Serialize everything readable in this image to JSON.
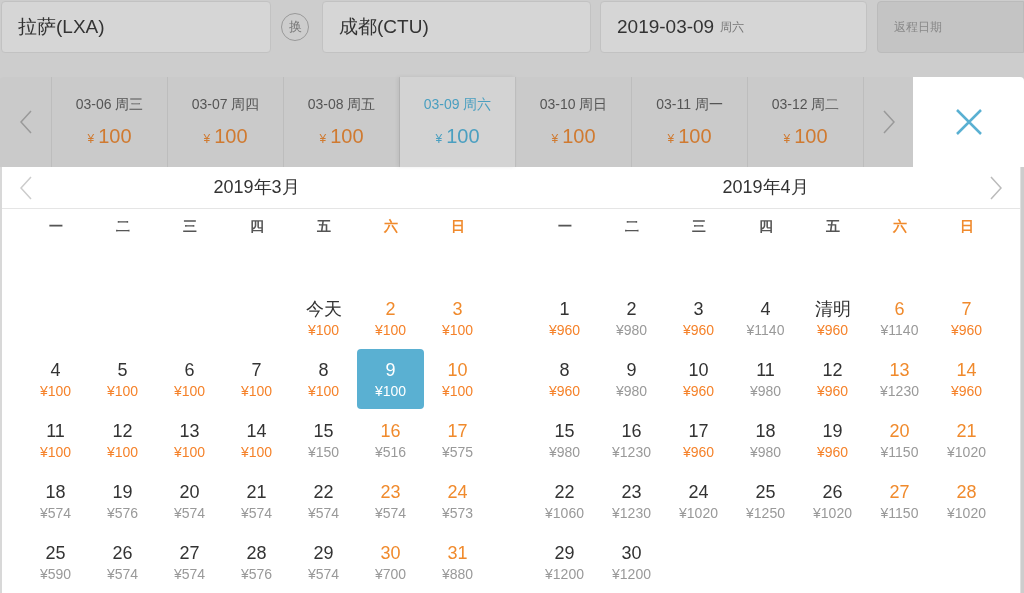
{
  "search": {
    "origin": "拉萨(LXA)",
    "swap": "换",
    "destination": "成都(CTU)",
    "depart_date": "2019-03-09",
    "depart_weekday": "周六",
    "return_placeholder": "返程日期"
  },
  "date_strip": [
    {
      "date": "03-06 周三",
      "currency": "¥",
      "price": "100",
      "selected": false
    },
    {
      "date": "03-07 周四",
      "currency": "¥",
      "price": "100",
      "selected": false
    },
    {
      "date": "03-08 周五",
      "currency": "¥",
      "price": "100",
      "selected": false
    },
    {
      "date": "03-09 周六",
      "currency": "¥",
      "price": "100",
      "selected": true
    },
    {
      "date": "03-10 周日",
      "currency": "¥",
      "price": "100",
      "selected": false
    },
    {
      "date": "03-11 周一",
      "currency": "¥",
      "price": "100",
      "selected": false
    },
    {
      "date": "03-12 周二",
      "currency": "¥",
      "price": "100",
      "selected": false
    }
  ],
  "calendars": [
    {
      "title": "2019年3月",
      "prev_arrow": true,
      "first_week_right_aligned": true,
      "weekdays": [
        {
          "label": "一",
          "weekend": false
        },
        {
          "label": "二",
          "weekend": false
        },
        {
          "label": "三",
          "weekend": false
        },
        {
          "label": "四",
          "weekend": false
        },
        {
          "label": "五",
          "weekend": false
        },
        {
          "label": "六",
          "weekend": true
        },
        {
          "label": "日",
          "weekend": true
        }
      ],
      "weeks": [
        [
          {
            "day": "今天",
            "price": "¥100",
            "low": true,
            "selected": false
          },
          {
            "day": "2",
            "price": "¥100",
            "low": true,
            "selected": false
          },
          {
            "day": "3",
            "price": "¥100",
            "low": true,
            "selected": false
          }
        ],
        [
          {
            "day": "4",
            "price": "¥100",
            "low": true,
            "selected": false
          },
          {
            "day": "5",
            "price": "¥100",
            "low": true,
            "selected": false
          },
          {
            "day": "6",
            "price": "¥100",
            "low": true,
            "selected": false
          },
          {
            "day": "7",
            "price": "¥100",
            "low": true,
            "selected": false
          },
          {
            "day": "8",
            "price": "¥100",
            "low": true,
            "selected": false
          },
          {
            "day": "9",
            "price": "¥100",
            "low": true,
            "selected": true
          },
          {
            "day": "10",
            "price": "¥100",
            "low": true,
            "selected": false
          }
        ],
        [
          {
            "day": "11",
            "price": "¥100",
            "low": true,
            "selected": false
          },
          {
            "day": "12",
            "price": "¥100",
            "low": true,
            "selected": false
          },
          {
            "day": "13",
            "price": "¥100",
            "low": true,
            "selected": false
          },
          {
            "day": "14",
            "price": "¥100",
            "low": true,
            "selected": false
          },
          {
            "day": "15",
            "price": "¥150",
            "low": false,
            "selected": false
          },
          {
            "day": "16",
            "price": "¥516",
            "low": false,
            "selected": false
          },
          {
            "day": "17",
            "price": "¥575",
            "low": false,
            "selected": false
          }
        ],
        [
          {
            "day": "18",
            "price": "¥574",
            "low": false,
            "selected": false
          },
          {
            "day": "19",
            "price": "¥576",
            "low": false,
            "selected": false
          },
          {
            "day": "20",
            "price": "¥574",
            "low": false,
            "selected": false
          },
          {
            "day": "21",
            "price": "¥574",
            "low": false,
            "selected": false
          },
          {
            "day": "22",
            "price": "¥574",
            "low": false,
            "selected": false
          },
          {
            "day": "23",
            "price": "¥574",
            "low": false,
            "selected": false
          },
          {
            "day": "24",
            "price": "¥573",
            "low": false,
            "selected": false
          }
        ],
        [
          {
            "day": "25",
            "price": "¥590",
            "low": false,
            "selected": false
          },
          {
            "day": "26",
            "price": "¥574",
            "low": false,
            "selected": false
          },
          {
            "day": "27",
            "price": "¥574",
            "low": false,
            "selected": false
          },
          {
            "day": "28",
            "price": "¥576",
            "low": false,
            "selected": false
          },
          {
            "day": "29",
            "price": "¥574",
            "low": false,
            "selected": false
          },
          {
            "day": "30",
            "price": "¥700",
            "low": false,
            "selected": false
          },
          {
            "day": "31",
            "price": "¥880",
            "low": false,
            "selected": false
          }
        ]
      ]
    },
    {
      "title": "2019年4月",
      "next_arrow": true,
      "weekdays": [
        {
          "label": "一",
          "weekend": false
        },
        {
          "label": "二",
          "weekend": false
        },
        {
          "label": "三",
          "weekend": false
        },
        {
          "label": "四",
          "weekend": false
        },
        {
          "label": "五",
          "weekend": false
        },
        {
          "label": "六",
          "weekend": true
        },
        {
          "label": "日",
          "weekend": true
        }
      ],
      "weeks": [
        [
          {
            "day": "1",
            "price": "¥960",
            "low": true,
            "selected": false
          },
          {
            "day": "2",
            "price": "¥980",
            "low": false,
            "selected": false
          },
          {
            "day": "3",
            "price": "¥960",
            "low": true,
            "selected": false
          },
          {
            "day": "4",
            "price": "¥1140",
            "low": false,
            "selected": false
          },
          {
            "day": "清明",
            "price": "¥960",
            "low": true,
            "selected": false
          },
          {
            "day": "6",
            "price": "¥1140",
            "low": false,
            "selected": false
          },
          {
            "day": "7",
            "price": "¥960",
            "low": true,
            "selected": false
          }
        ],
        [
          {
            "day": "8",
            "price": "¥960",
            "low": true,
            "selected": false
          },
          {
            "day": "9",
            "price": "¥980",
            "low": false,
            "selected": false
          },
          {
            "day": "10",
            "price": "¥960",
            "low": true,
            "selected": false
          },
          {
            "day": "11",
            "price": "¥980",
            "low": false,
            "selected": false
          },
          {
            "day": "12",
            "price": "¥960",
            "low": true,
            "selected": false
          },
          {
            "day": "13",
            "price": "¥1230",
            "low": false,
            "selected": false
          },
          {
            "day": "14",
            "price": "¥960",
            "low": true,
            "selected": false
          }
        ],
        [
          {
            "day": "15",
            "price": "¥980",
            "low": false,
            "selected": false
          },
          {
            "day": "16",
            "price": "¥1230",
            "low": false,
            "selected": false
          },
          {
            "day": "17",
            "price": "¥960",
            "low": true,
            "selected": false
          },
          {
            "day": "18",
            "price": "¥980",
            "low": false,
            "selected": false
          },
          {
            "day": "19",
            "price": "¥960",
            "low": true,
            "selected": false
          },
          {
            "day": "20",
            "price": "¥1150",
            "low": false,
            "selected": false
          },
          {
            "day": "21",
            "price": "¥1020",
            "low": false,
            "selected": false
          }
        ],
        [
          {
            "day": "22",
            "price": "¥1060",
            "low": false,
            "selected": false
          },
          {
            "day": "23",
            "price": "¥1230",
            "low": false,
            "selected": false
          },
          {
            "day": "24",
            "price": "¥1020",
            "low": false,
            "selected": false
          },
          {
            "day": "25",
            "price": "¥1250",
            "low": false,
            "selected": false
          },
          {
            "day": "26",
            "price": "¥1020",
            "low": false,
            "selected": false
          },
          {
            "day": "27",
            "price": "¥1150",
            "low": false,
            "selected": false
          },
          {
            "day": "28",
            "price": "¥1020",
            "low": false,
            "selected": false
          }
        ],
        [
          {
            "day": "29",
            "price": "¥1200",
            "low": false,
            "selected": false
          },
          {
            "day": "30",
            "price": "¥1200",
            "low": false,
            "selected": false
          }
        ]
      ]
    }
  ]
}
